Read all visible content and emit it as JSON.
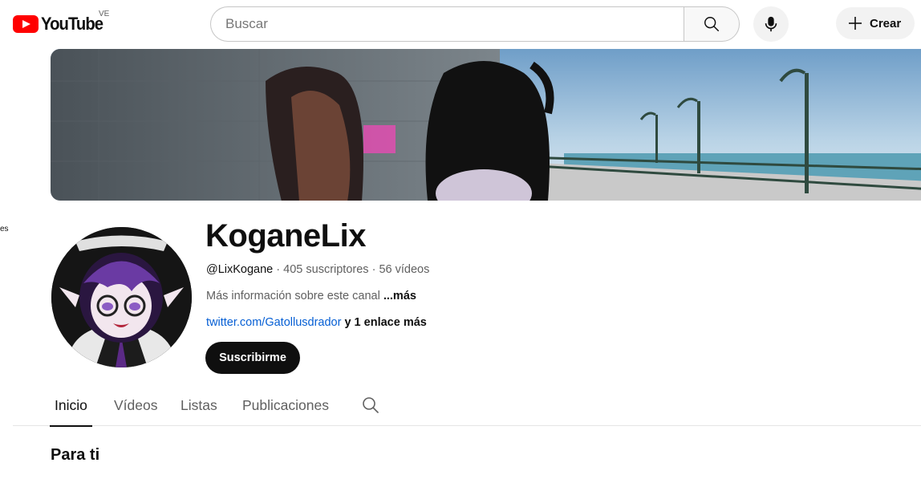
{
  "header": {
    "logo_text": "YouTube",
    "region": "VE",
    "search_placeholder": "Buscar",
    "create_label": "Crear"
  },
  "sidebar_fragment": "es",
  "channel": {
    "name": "KoganeLix",
    "handle": "@LixKogane",
    "subscribers": "405 suscriptores",
    "videos": "56 vídeos",
    "separator": "·",
    "description": "Más información sobre este canal",
    "more_label": "...más",
    "link_url": "twitter.com/Gatollusdrador",
    "link_extra": "y 1 enlace más",
    "subscribe_label": "Suscribirme"
  },
  "tabs": [
    {
      "label": "Inicio",
      "active": true
    },
    {
      "label": "Vídeos",
      "active": false
    },
    {
      "label": "Listas",
      "active": false
    },
    {
      "label": "Publicaciones",
      "active": false
    }
  ],
  "section": {
    "title": "Para ti"
  },
  "colors": {
    "brand_red": "#ff0000",
    "link_blue": "#065fd4",
    "text_primary": "#0f0f0f",
    "text_secondary": "#606060"
  }
}
